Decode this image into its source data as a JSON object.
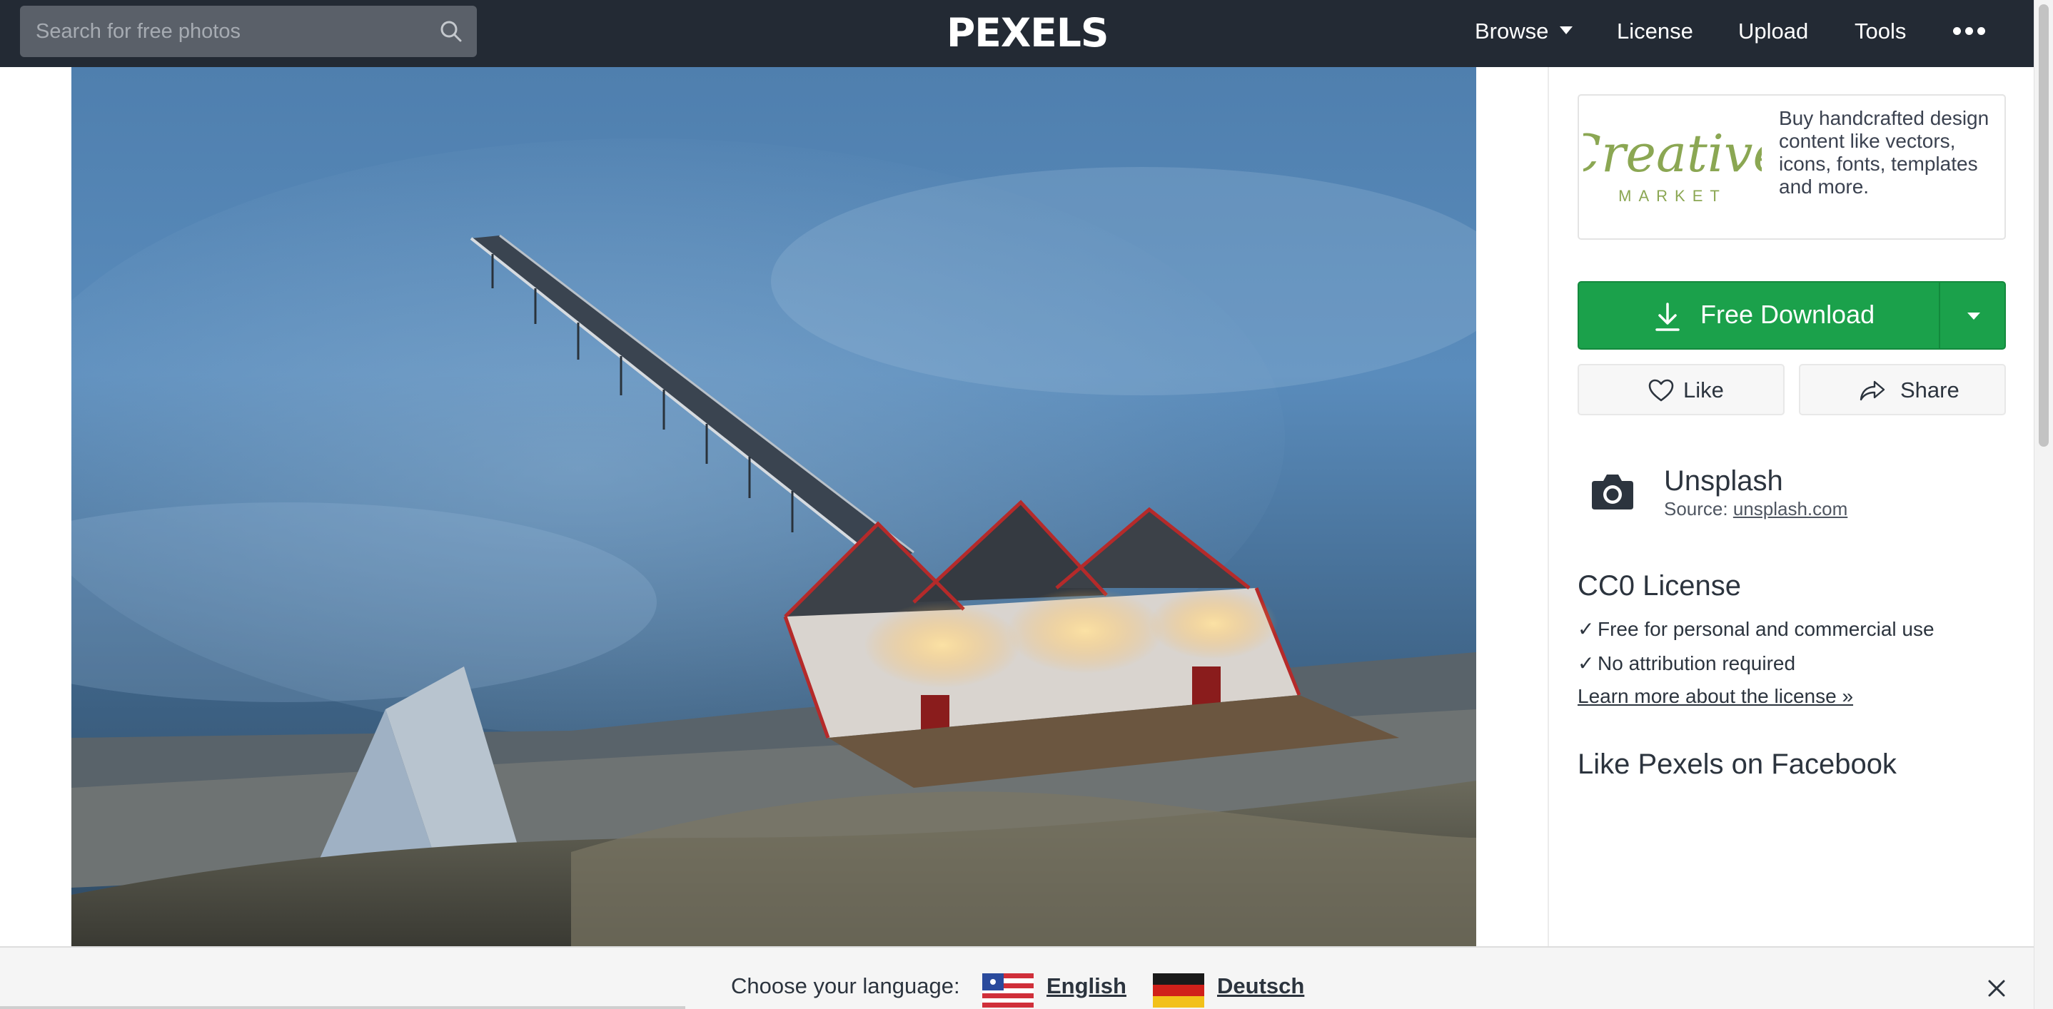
{
  "header": {
    "search": {
      "placeholder": "Search for free photos",
      "value": "",
      "icon": "search-icon"
    },
    "logo": "PEXELS",
    "nav": {
      "browse": "Browse",
      "license": "License",
      "upload": "Upload",
      "tools": "Tools",
      "more_icon": "more-dots-icon"
    }
  },
  "photo": {
    "subject_icon": "photo"
  },
  "sidebar": {
    "ad": {
      "logo_text": "Creative",
      "logo_subtext": "MARKET",
      "text": "Buy handcrafted design content like vectors, icons, fonts, templates and more."
    },
    "download": {
      "label": "Free Download",
      "icon": "download-icon",
      "dropdown_icon": "caret-down-icon"
    },
    "like": {
      "label": "Like",
      "icon": "heart-icon"
    },
    "share": {
      "label": "Share",
      "icon": "share-icon"
    },
    "author": {
      "name": "Unsplash",
      "source_label": "Source:",
      "source_link": "unsplash.com",
      "icon": "camera-icon"
    },
    "license": {
      "title": "CC0 License",
      "items": [
        "Free for personal and commercial use",
        "No attribution required"
      ],
      "check": "✓",
      "more_link": "Learn more about the license »"
    },
    "facebook_title": "Like Pexels on Facebook"
  },
  "language_bar": {
    "prompt": "Choose your language:",
    "options": [
      {
        "label": "English",
        "flag": "us-flag-icon"
      },
      {
        "label": "Deutsch",
        "flag": "de-flag-icon"
      }
    ],
    "close_icon": "close-icon"
  },
  "colors": {
    "nav_bg": "#232a34",
    "download_green": "#1ba14b",
    "creative_market_green": "#8ba753"
  }
}
